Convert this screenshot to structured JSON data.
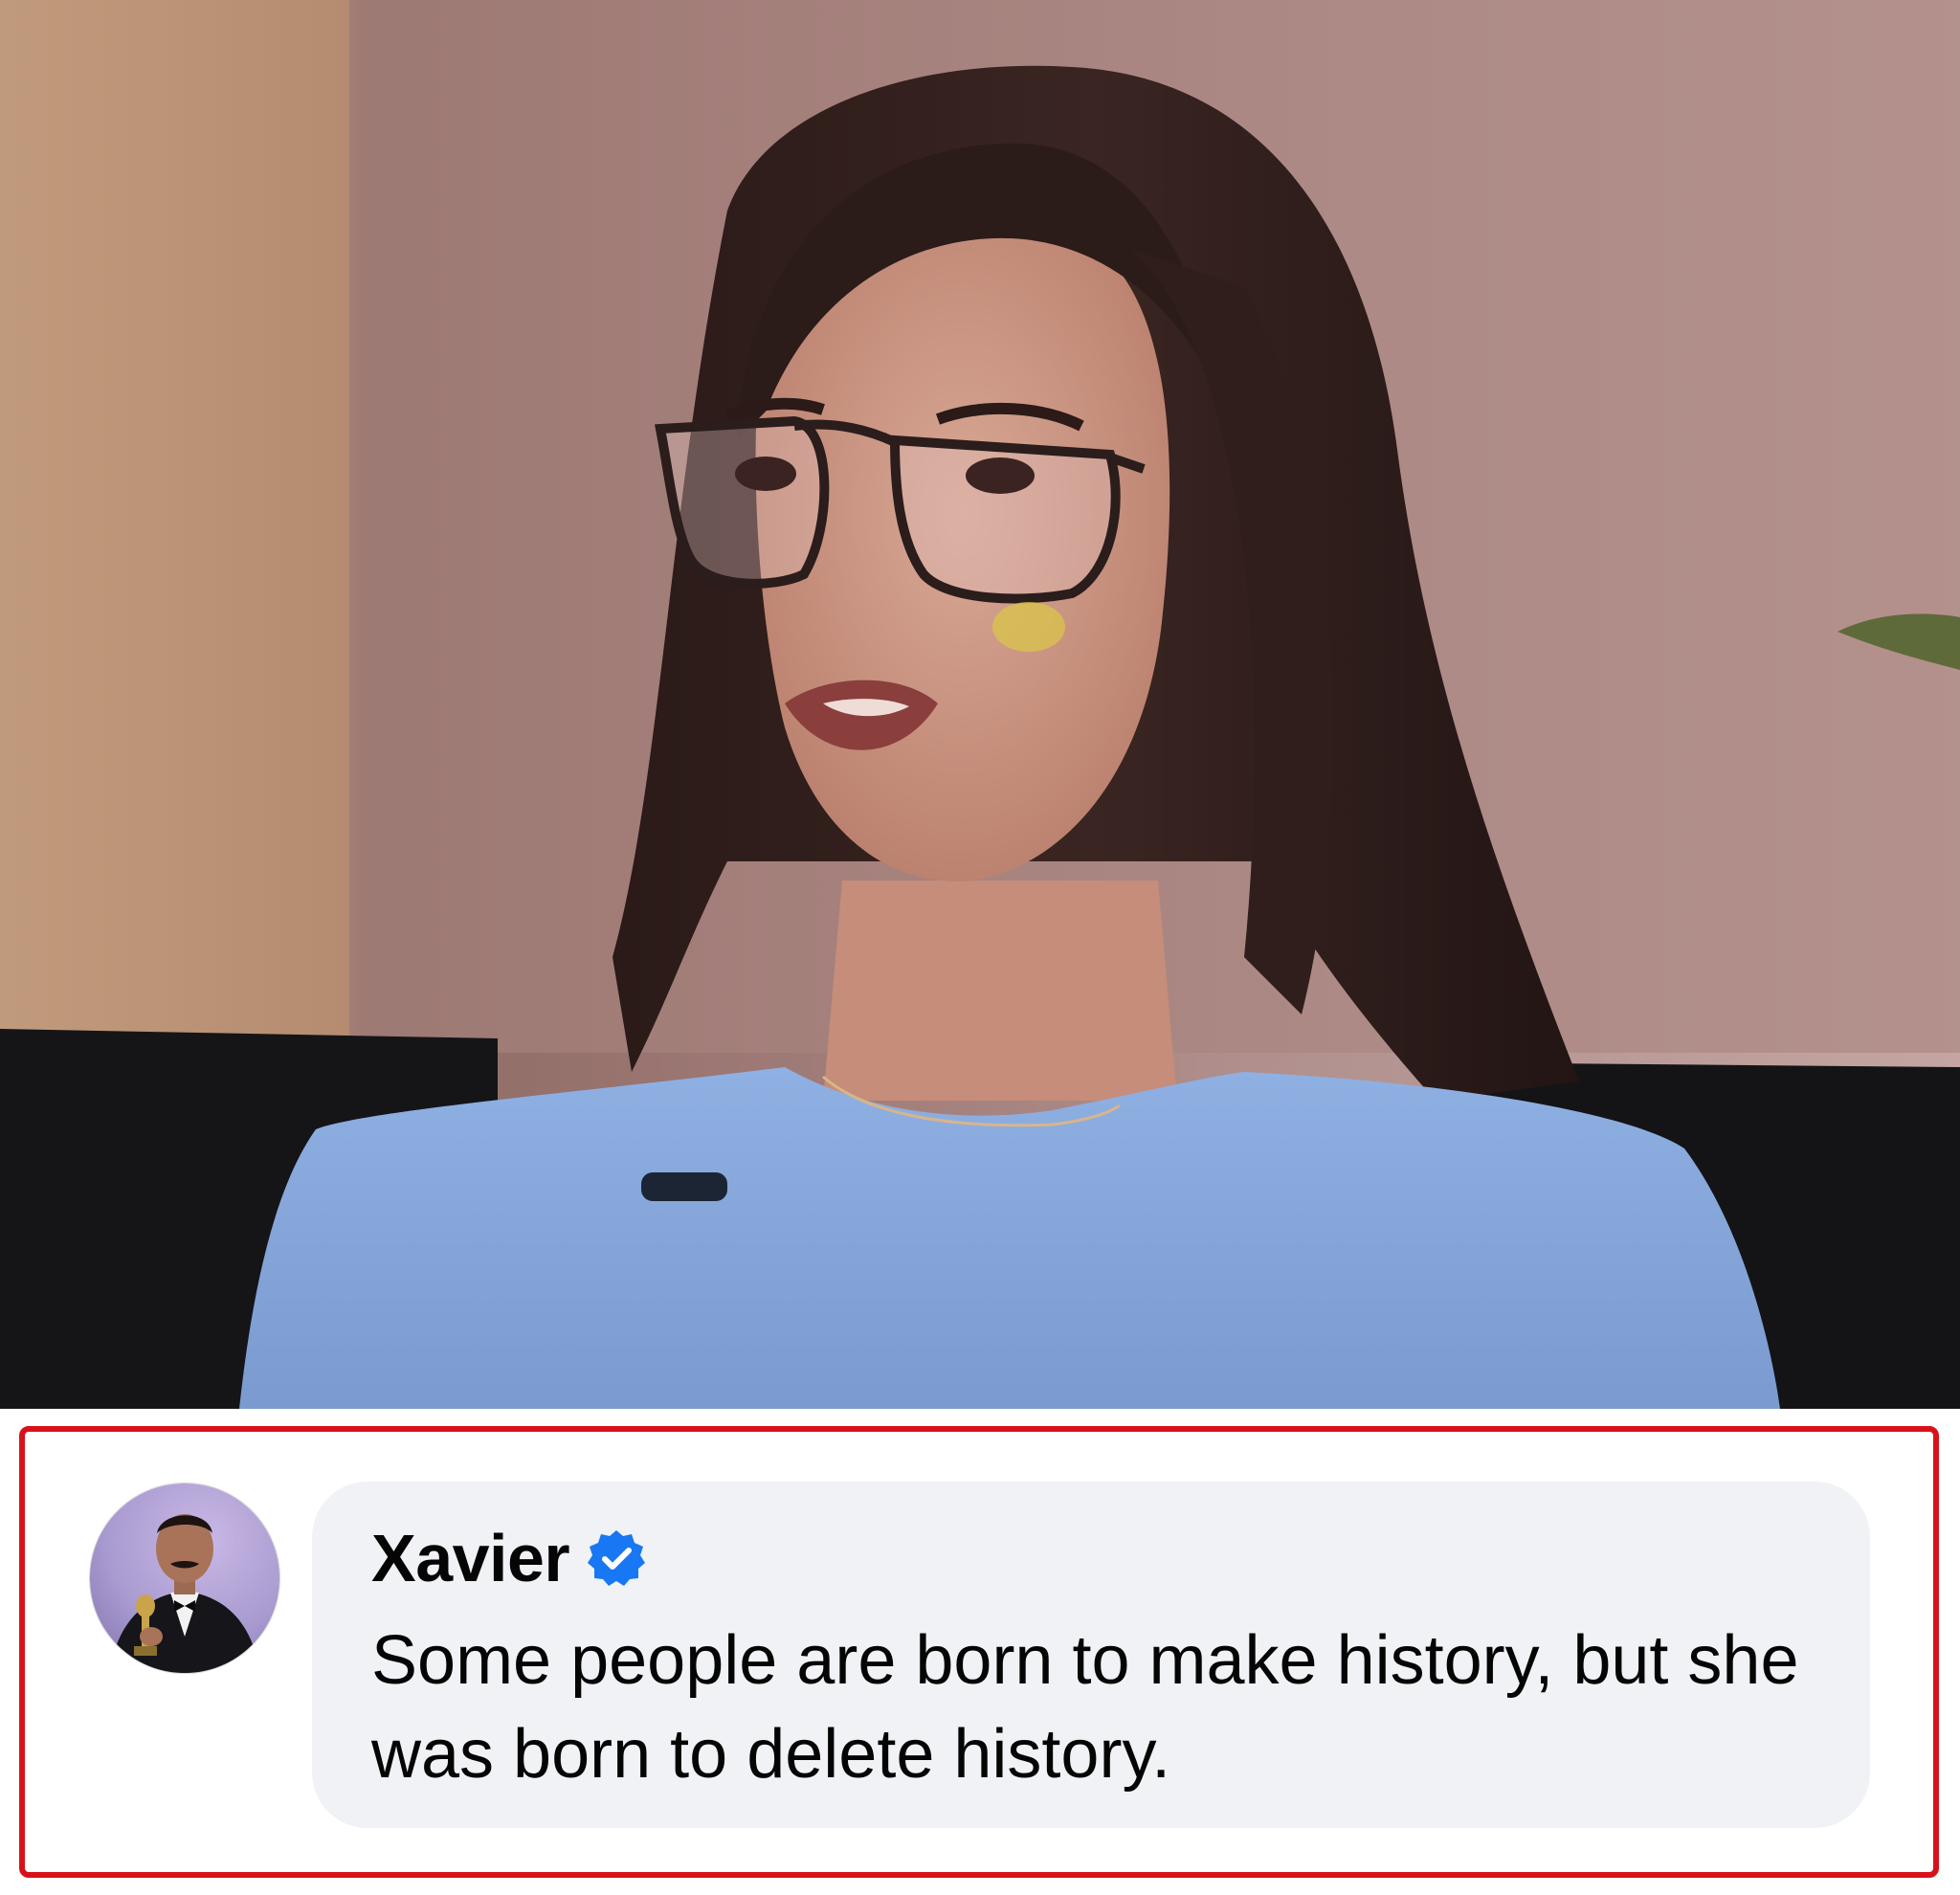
{
  "image": {
    "description_label": "photo"
  },
  "comment": {
    "author": "Xavier",
    "verified": true,
    "text": "Some people are born to make history, but she was born to delete history."
  },
  "colors": {
    "highlight_border": "#d8121a",
    "bubble_background": "#f0f2f5",
    "verified_badge": "#1877f2",
    "text": "#050505"
  },
  "icons": {
    "verified": "verified-badge-icon"
  }
}
